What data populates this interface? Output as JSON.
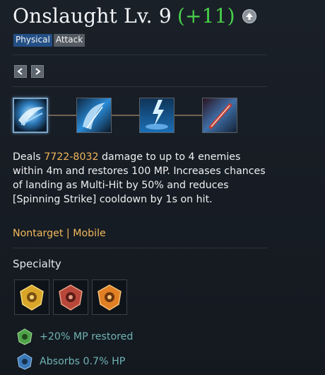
{
  "skill": {
    "name": "Onslaught Lv. 9",
    "bonus_level": "(+11)",
    "tags": [
      "Physical",
      "Attack"
    ]
  },
  "nav": {
    "prev_icon": "chevron-left-icon",
    "next_icon": "chevron-right-icon"
  },
  "tripods": [
    {
      "icon": "ice-slash-icon",
      "selected": true
    },
    {
      "icon": "blade-wave-icon",
      "selected": false
    },
    {
      "icon": "lightning-strike-icon",
      "selected": false
    },
    {
      "icon": "crimson-slash-icon",
      "selected": false
    }
  ],
  "description": {
    "pre": "Deals ",
    "damage": "7722-8032",
    "post": " damage to up to 4 enemies within 4m and restores 100 MP. Increases chances of landing as Multi-Hit by 50% and reduces [Spinning Strike] cooldown by 1s on hit."
  },
  "traits": "Nontarget | Mobile",
  "specialty": {
    "title": "Specialty",
    "gems": [
      {
        "icon": "gold-rune-gem-icon",
        "color": "#d9a62a"
      },
      {
        "icon": "red-rune-gem-icon",
        "color": "#b8473a"
      },
      {
        "icon": "orange-rune-gem-icon",
        "color": "#e07f24"
      }
    ]
  },
  "bonuses": [
    {
      "text": "+20% MP restored",
      "icon": "green-gem-icon",
      "color": "#4fa24a"
    },
    {
      "text": "Absorbs 0.7% HP",
      "icon": "blue-gem-icon",
      "color": "#3a78b8"
    }
  ],
  "colors": {
    "accent_gold": "#f0b55a",
    "level_green": "#49d04a",
    "bonus_teal": "#6fb3b3"
  }
}
